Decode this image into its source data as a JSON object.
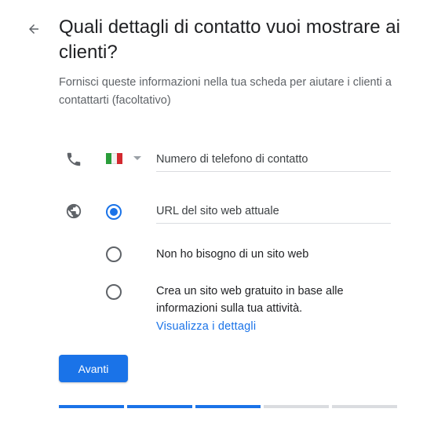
{
  "header": {
    "title": "Quali dettagli di contatto vuoi mostrare ai clienti?",
    "subtitle": "Fornisci queste informazioni nella tua scheda per aiutare i clienti a contattarti (facoltativo)"
  },
  "phone": {
    "icon": "phone-icon",
    "country_flag": "italy-flag-icon",
    "placeholder": "Numero di telefono di contatto"
  },
  "website": {
    "icon": "globe-icon",
    "options": [
      {
        "label": "URL del sito web attuale",
        "selected": true
      },
      {
        "label": "Non ho bisogno di un sito web",
        "selected": false
      },
      {
        "label": "Crea un sito web gratuito in base alle informazioni sulla tua attività.",
        "selected": false
      }
    ],
    "details_link": "Visualizza i dettagli"
  },
  "actions": {
    "next_label": "Avanti"
  },
  "progress": {
    "total_steps": 5,
    "completed_steps": 3
  },
  "colors": {
    "accent": "#1a73e8",
    "text_primary": "#202124",
    "text_secondary": "#5f6368",
    "divider": "#dadce0"
  }
}
